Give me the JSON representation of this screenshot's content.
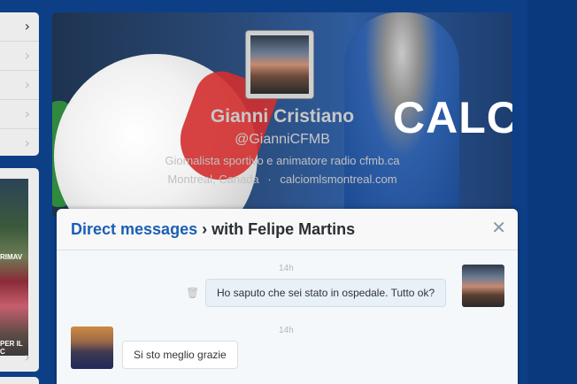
{
  "profile": {
    "name": "Gianni Cristiano",
    "handle": "@GianniCFMB",
    "bio": "Giornalista sportivo e animatore radio cfmb.ca",
    "location": "Montreal, Canada",
    "separator": "·",
    "website": "calciomlsmontreal.com",
    "header_text": "CALCI"
  },
  "left_sidebar": {
    "thumb_labels": [
      "RIMAV",
      "PER IL C"
    ]
  },
  "dm": {
    "title_link": "Direct messages",
    "title_sep": "›",
    "title_with": "with Felipe Martins",
    "close_glyph": "✕",
    "messages": [
      {
        "time": "14h",
        "text": "Ho saputo che sei stato in ospedale. Tutto ok?",
        "direction": "outgoing"
      },
      {
        "time": "14h",
        "text": "Si sto meglio grazie",
        "direction": "incoming"
      }
    ]
  },
  "icons": {
    "chevron": "›",
    "trash": "🗑"
  }
}
